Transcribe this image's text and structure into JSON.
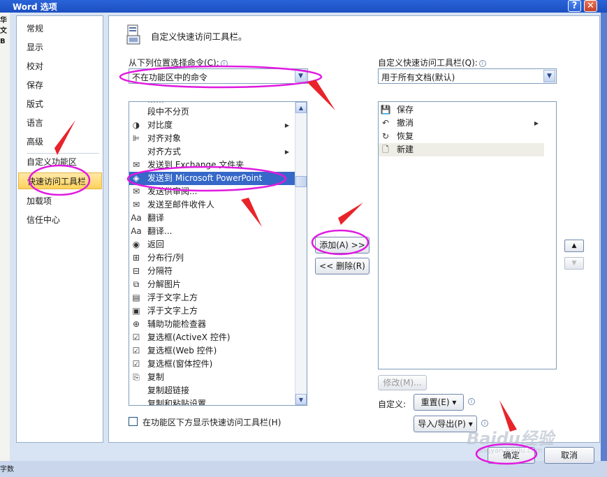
{
  "window": {
    "title": "Word 选项",
    "help_glyph": "?",
    "close_glyph": "✕"
  },
  "edge_text": {
    "top": "华文",
    "mid": "B",
    "bottom": "字数"
  },
  "nav": {
    "items": [
      {
        "label": "常规"
      },
      {
        "label": "显示"
      },
      {
        "label": "校对"
      },
      {
        "label": "保存"
      },
      {
        "label": "版式"
      },
      {
        "label": "语言"
      },
      {
        "label": "高级"
      },
      {
        "label": "自定义功能区"
      },
      {
        "label": "快速访问工具栏"
      },
      {
        "label": "加载项"
      },
      {
        "label": "信任中心"
      }
    ]
  },
  "header": {
    "title": "自定义快速访问工具栏。"
  },
  "left_panel": {
    "choose_label": "从下列位置选择命令(C):",
    "choose_value": "不在功能区中的命令",
    "commands": [
      {
        "label": "段中不分页",
        "icon": "",
        "sub": ""
      },
      {
        "label": "对比度",
        "icon": "◑",
        "sub": "▶"
      },
      {
        "label": "对齐对象",
        "icon": "⊫",
        "sub": ""
      },
      {
        "label": "对齐方式",
        "icon": "",
        "sub": "▶"
      },
      {
        "label": "发送到 Exchange 文件夹",
        "icon": "✉",
        "sub": ""
      },
      {
        "label": "发送到 Microsoft PowerPoint",
        "icon": "◈",
        "sub": ""
      },
      {
        "label": "发送供审阅...",
        "icon": "✉",
        "sub": ""
      },
      {
        "label": "发送至邮件收件人",
        "icon": "✉",
        "sub": ""
      },
      {
        "label": "翻译",
        "icon": "Aa",
        "sub": ""
      },
      {
        "label": "翻译...",
        "icon": "Aa",
        "sub": ""
      },
      {
        "label": "返回",
        "icon": "◉",
        "sub": ""
      },
      {
        "label": "分布行/列",
        "icon": "⊞",
        "sub": ""
      },
      {
        "label": "分隔符",
        "icon": "⊟",
        "sub": ""
      },
      {
        "label": "分解图片",
        "icon": "⧉",
        "sub": ""
      },
      {
        "label": "浮于文字上方",
        "icon": "▤",
        "sub": ""
      },
      {
        "label": "浮于文字上方",
        "icon": "▣",
        "sub": ""
      },
      {
        "label": "辅助功能检查器",
        "icon": "⊕",
        "sub": ""
      },
      {
        "label": "复选框(ActiveX 控件)",
        "icon": "☑",
        "sub": ""
      },
      {
        "label": "复选框(Web 控件)",
        "icon": "☑",
        "sub": ""
      },
      {
        "label": "复选框(窗体控件)",
        "icon": "☑",
        "sub": ""
      },
      {
        "label": "复制",
        "icon": "⎘",
        "sub": ""
      },
      {
        "label": "复制超链接",
        "icon": "",
        "sub": ""
      },
      {
        "label": "复制和粘贴设置",
        "icon": "",
        "sub": ""
      }
    ],
    "show_below_label": "在功能区下方显示快速访问工具栏(H)"
  },
  "right_panel": {
    "customize_label": "自定义快速访问工具栏(Q):",
    "customize_value": "用于所有文档(默认)",
    "items": [
      {
        "label": "保存",
        "icon": "💾",
        "sub": ""
      },
      {
        "label": "撤消",
        "icon": "↶",
        "sub": "▶"
      },
      {
        "label": "恢复",
        "icon": "↻",
        "sub": ""
      },
      {
        "label": "新建",
        "icon": "🗋",
        "sub": ""
      }
    ],
    "modify_label": "修改(M)...",
    "custom_label": "自定义:",
    "reset_label": "重置(E) ▾",
    "import_label": "导入/导出(P) ▾"
  },
  "buttons": {
    "add": "添加(A) >>",
    "remove": "<< 删除(R)",
    "ok": "确定",
    "cancel": "取消",
    "up": "▲",
    "down": "▼"
  },
  "colors": {
    "highlight": "#3568c8",
    "annotation": "#e01ae0",
    "arrow": "#e8242a"
  },
  "watermark": {
    "text": "Baidu经验",
    "sub": "jingyan.baidu.com"
  }
}
